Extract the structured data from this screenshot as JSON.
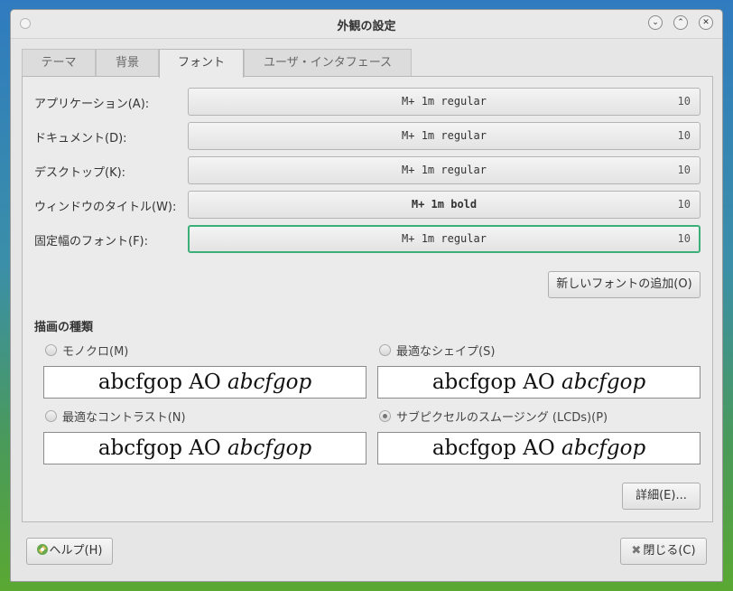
{
  "window": {
    "title": "外観の設定"
  },
  "tabs": [
    {
      "label": "テーマ"
    },
    {
      "label": "背景"
    },
    {
      "label": "フォント"
    },
    {
      "label": "ユーザ・インタフェース"
    }
  ],
  "fonts": [
    {
      "label": "アプリケーション(A):",
      "font": "M+ 1m regular",
      "size": "10"
    },
    {
      "label": "ドキュメント(D):",
      "font": "M+ 1m regular",
      "size": "10"
    },
    {
      "label": "デスクトップ(K):",
      "font": "M+ 1m regular",
      "size": "10"
    },
    {
      "label": "ウィンドウのタイトル(W):",
      "font": "M+ 1m bold",
      "size": "10"
    },
    {
      "label": "固定幅のフォント(F):",
      "font": "M+ 1m regular",
      "size": "10"
    }
  ],
  "add_font_button": "新しいフォントの追加(O)",
  "rendering": {
    "title": "描画の種類",
    "sample_regular": "abcfgop AO",
    "sample_italic": "abcfgop",
    "options": [
      {
        "label": "モノクロ(M)",
        "selected": false
      },
      {
        "label": "最適なシェイプ(S)",
        "selected": false
      },
      {
        "label": "最適なコントラスト(N)",
        "selected": false
      },
      {
        "label": "サブピクセルのスムージング (LCDs)(P)",
        "selected": true
      }
    ]
  },
  "details_button": "詳細(E)...",
  "help_button": "ヘルプ(H)",
  "close_button": "閉じる(C)",
  "colors": {
    "focus_border": "#3cae78",
    "desktop_top": "#2f7bbf",
    "desktop_bottom": "#5aa832"
  }
}
